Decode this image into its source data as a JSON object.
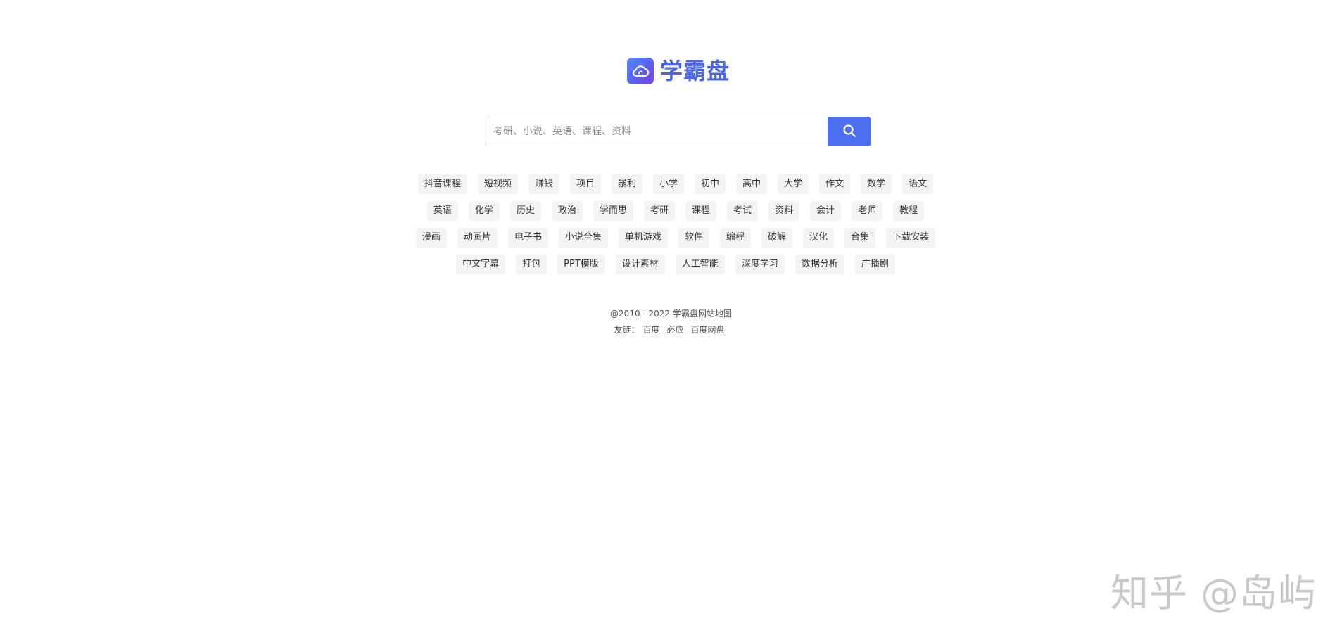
{
  "logo": {
    "text": "学霸盘",
    "icon": "cloud-icon"
  },
  "search": {
    "placeholder": "考研、小说、英语、课程、资料",
    "button_icon": "search-icon",
    "accent_color": "#4c6ef0"
  },
  "tags": [
    [
      "抖音课程",
      "短视频",
      "赚钱",
      "项目",
      "暴利",
      "小学",
      "初中",
      "高中",
      "大学",
      "作文",
      "数学",
      "语文"
    ],
    [
      "英语",
      "化学",
      "历史",
      "政治",
      "学而思",
      "考研",
      "课程",
      "考试",
      "资料",
      "会计",
      "老师",
      "教程"
    ],
    [
      "漫画",
      "动画片",
      "电子书",
      "小说全集",
      "单机游戏",
      "软件",
      "编程",
      "破解",
      "汉化",
      "合集",
      "下载安装"
    ],
    [
      "中文字幕",
      "打包",
      "PPT模版",
      "设计素材",
      "人工智能",
      "深度学习",
      "数据分析",
      "广播剧"
    ]
  ],
  "footer": {
    "copyright": "@2010 - 2022",
    "site_name": "学霸盘",
    "sitemap": "网站地图",
    "friends_label": "友链：",
    "friend_links": [
      "百度",
      "必应",
      "百度网盘"
    ]
  },
  "watermark": "知乎 @岛屿"
}
